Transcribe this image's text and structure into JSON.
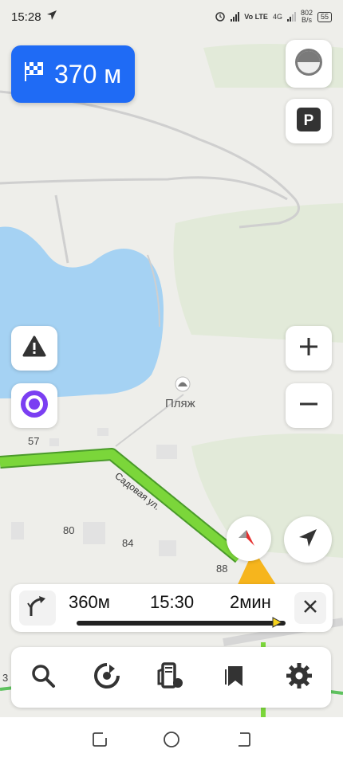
{
  "status_bar": {
    "time": "15:28",
    "network_label": "Vo LTE",
    "network_4g": "4G",
    "speed_value": "802",
    "speed_unit": "B/s",
    "battery": "55"
  },
  "navigation": {
    "distance_to_finish": "370 м"
  },
  "map": {
    "poi_label": "Пляж",
    "street_label": "Садовая ул.",
    "house_numbers": [
      "57",
      "80",
      "84",
      "88",
      "3"
    ]
  },
  "route": {
    "distance": "360м",
    "arrival_time": "15:30",
    "duration": "2мин"
  },
  "colors": {
    "accent_blue": "#1f6bf5",
    "route_green": "#7bd63a",
    "water": "#a5d2f3",
    "alice_purple": "#7b3ff2"
  },
  "icons": {
    "finish": "checkered-flag-icon",
    "parking": "parking-icon",
    "warning": "warning-icon",
    "alice": "alice-voice-assistant-icon",
    "zoom_in": "plus-icon",
    "zoom_out": "minus-icon",
    "compass": "compass-icon",
    "locate": "navigation-arrow-icon",
    "turn": "turn-right-icon",
    "close": "close-icon",
    "search": "search-icon",
    "music": "music-icon",
    "fuel": "fuel-station-icon",
    "bookmarks": "bookmark-icon",
    "settings": "gear-icon"
  },
  "system_nav": {
    "items": [
      "recent-apps",
      "home",
      "back"
    ]
  }
}
